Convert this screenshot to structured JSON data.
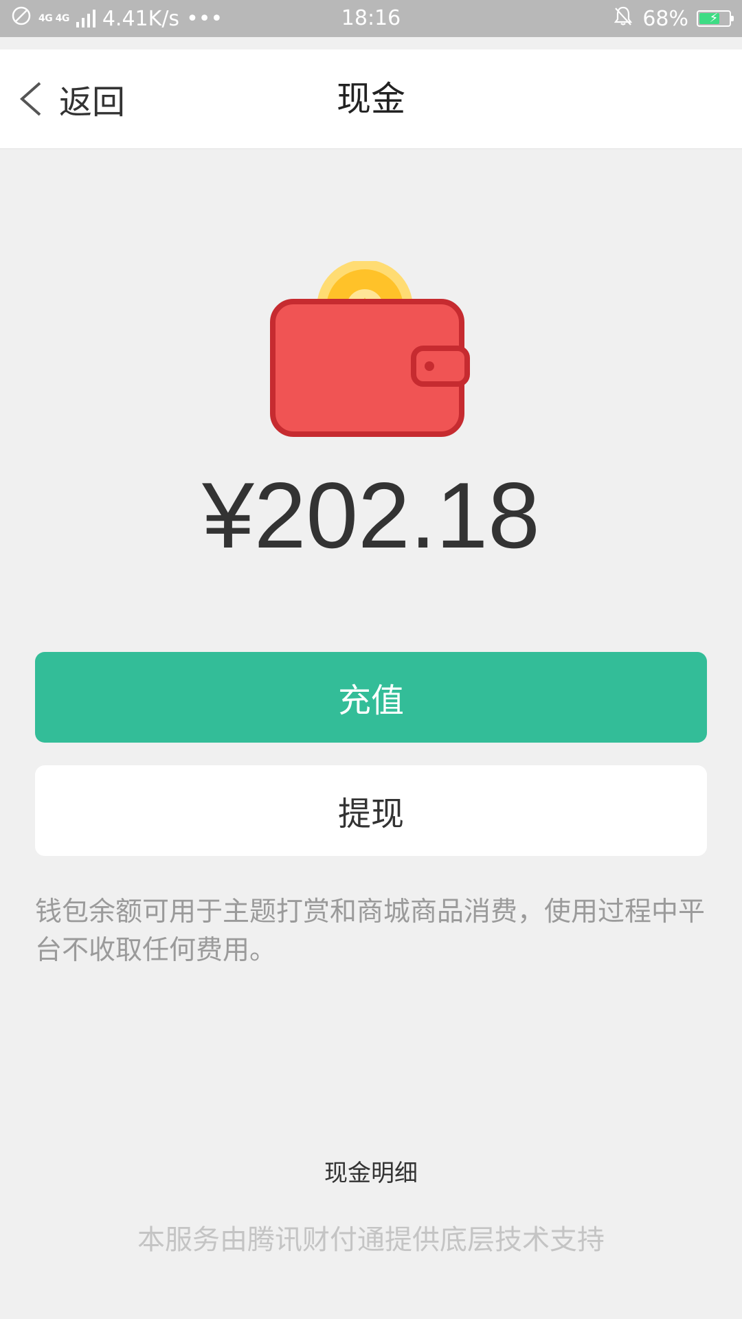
{
  "status_bar": {
    "net_label": "4G 4G",
    "speed": "4.41K/s",
    "more": "•••",
    "time": "18:16",
    "battery": "68%",
    "battery_level": 0.68,
    "icons": [
      "no-disturb-icon",
      "signal-icon",
      "bell-muted-icon",
      "battery-icon"
    ]
  },
  "nav": {
    "back_label": "返回",
    "title": "现金"
  },
  "wallet": {
    "icon": "wallet-with-coin-icon",
    "balance": "¥202.18",
    "colors": {
      "wallet": "#f05454",
      "wallet_border": "#c62b30",
      "coin": "#ffc933"
    }
  },
  "actions": {
    "recharge_label": "充值",
    "withdraw_label": "提现",
    "accent": "#33bd98"
  },
  "info": {
    "text": "钱包余额可用于主题打赏和商城商品消费，使用过程中平台不收取任何费用。"
  },
  "footer": {
    "details_link": "现金明细",
    "powered_by": "本服务由腾讯财付通提供底层技术支持"
  }
}
